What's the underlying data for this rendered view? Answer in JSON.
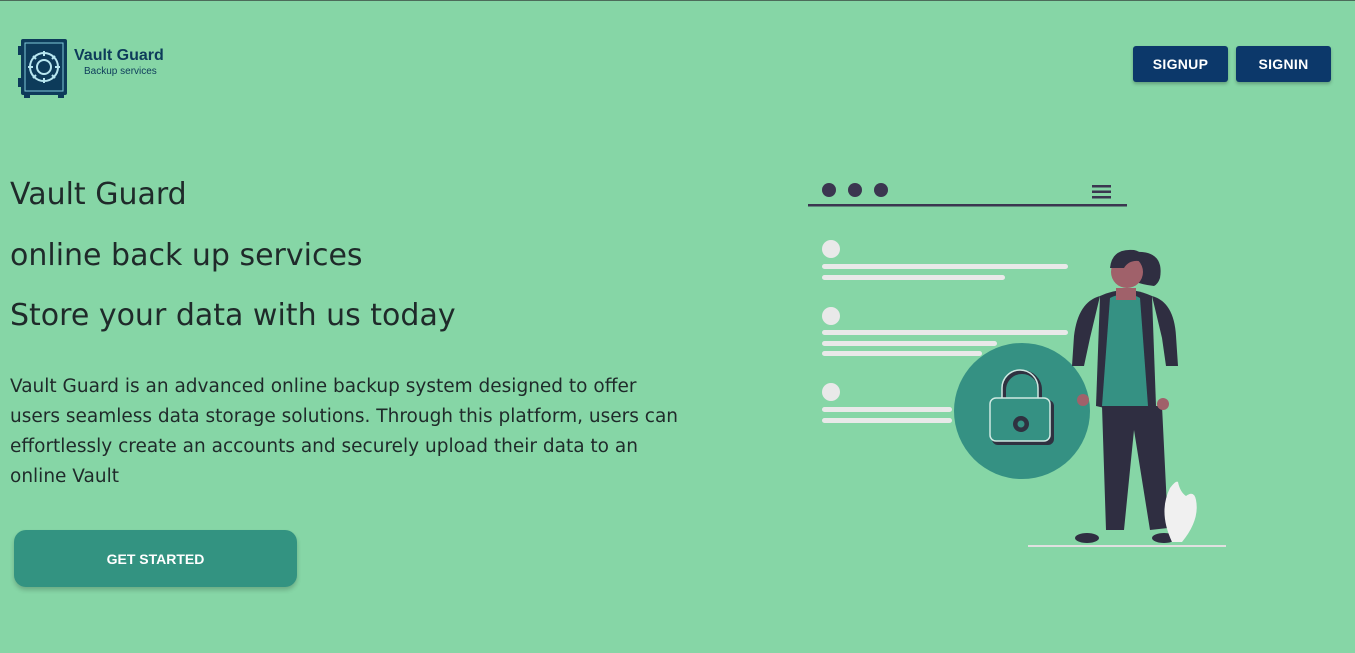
{
  "brand": {
    "title": "Vault Guard",
    "subtitle": "Backup services"
  },
  "nav": {
    "signup_label": "SIGNUP",
    "signin_label": "SIGNIN"
  },
  "hero": {
    "line1": "Vault Guard",
    "line2": "online back up services",
    "line3": "Store your data with us today",
    "description": "Vault Guard is an advanced online backup system designed to offer users seamless data storage solutions. Through this platform, users can effortlessly create an accounts and securely upload their data to an online Vault",
    "cta_label": "GET STARTED"
  },
  "colors": {
    "background": "#86d6a6",
    "nav_button": "#0c386a",
    "cta_button": "#339381",
    "text": "#1f2a2a"
  },
  "icons": [
    "vault-logo-icon",
    "menu-icon",
    "padlock-icon"
  ]
}
